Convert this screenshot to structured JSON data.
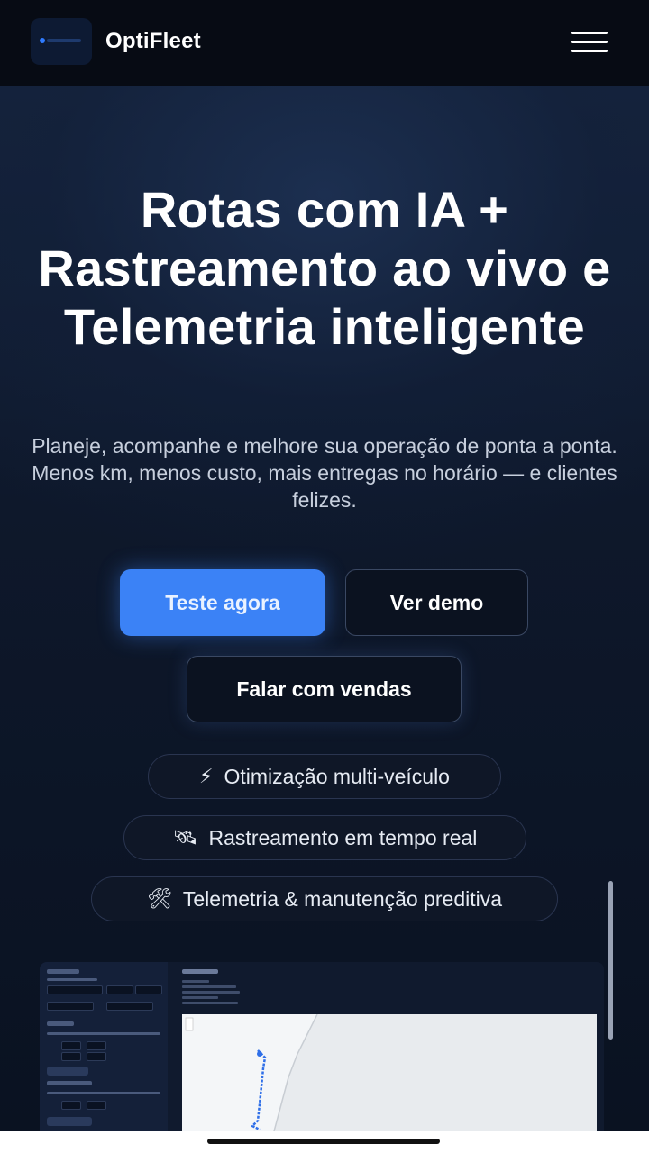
{
  "header": {
    "brand": "OptiFleet",
    "logo_icon": "logo-icon",
    "menu_icon": "hamburger-menu-icon"
  },
  "hero": {
    "title": "Rotas com IA + Rastreamento ao vivo e Telemetria inteligente",
    "subtitle_line1": "Planeje, acompanhe e melhore sua operação de ponta a ponta.",
    "subtitle_line2": "Menos km, menos custo, mais entregas no horário — e clientes felizes."
  },
  "buttons": {
    "primary": "Teste agora",
    "demo": "Ver demo",
    "sales": "Falar com vendas"
  },
  "chips": [
    {
      "icon": "⚡",
      "icon_name": "lightning-icon",
      "label": "Otimização multi-veículo"
    },
    {
      "icon": "🛰",
      "icon_name": "satellite-icon",
      "label": "Rastreamento em tempo real"
    },
    {
      "icon": "🛠",
      "icon_name": "tools-icon",
      "label": "Telemetria & manutenção preditiva"
    }
  ],
  "colors": {
    "accent": "#3b82f6",
    "background": "#0b1322",
    "topbar": "#070b14"
  }
}
